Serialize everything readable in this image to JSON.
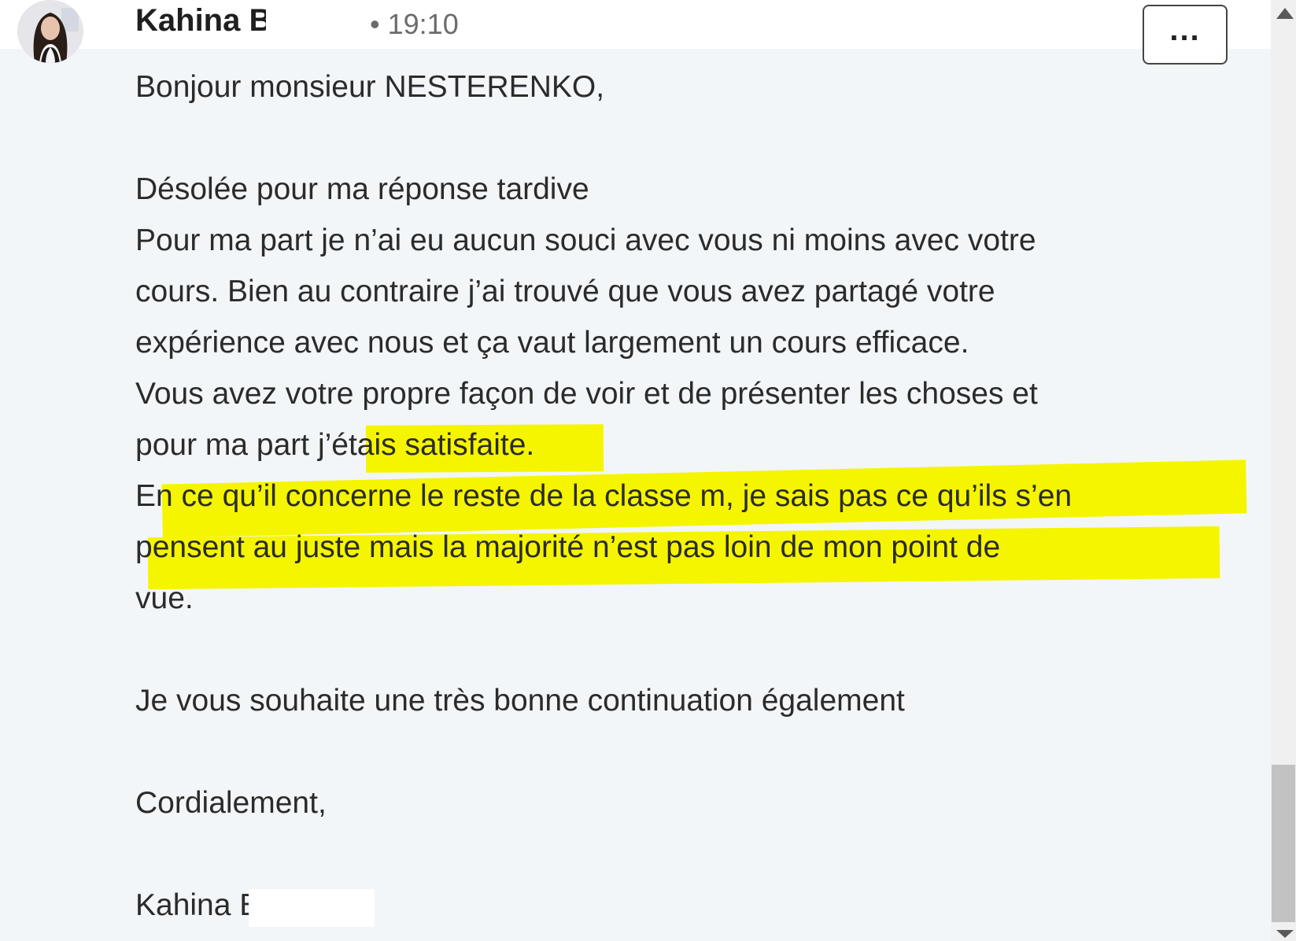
{
  "message": {
    "sender": "Kahina B",
    "sep": "•",
    "time": "19:10",
    "more_label": "...",
    "lines": [
      "Bonjour monsieur NESTERENKO,",
      "Désolée pour ma réponse tardive",
      "Pour ma part je n’ai eu aucun souci avec vous ni moins avec votre",
      "cours. Bien au contraire j’ai trouvé que vous avez partagé votre",
      "expérience avec nous et ça vaut largement un cours efficace.",
      "Vous avez votre propre façon de voir et de présenter les choses et",
      "pour ma part j’étais satisfaite.",
      "En ce qu’il concerne le reste de la classe m, je sais pas ce qu’ils s’en",
      "pensent au juste mais la majorité n’est pas loin de mon point de",
      "vue.",
      "Je vous souhaite une très bonne continuation également",
      "Cordialement,",
      "Kahina B"
    ]
  },
  "icons": {
    "avatar": "avatar-icon",
    "more": "more-options-icon",
    "scroll_up": "scroll-up-arrow-icon",
    "scroll_down": "scroll-down-arrow-icon"
  },
  "colors": {
    "highlight": "#f5f500",
    "background": "#f2f6f8",
    "text": "#2b2b2b"
  }
}
